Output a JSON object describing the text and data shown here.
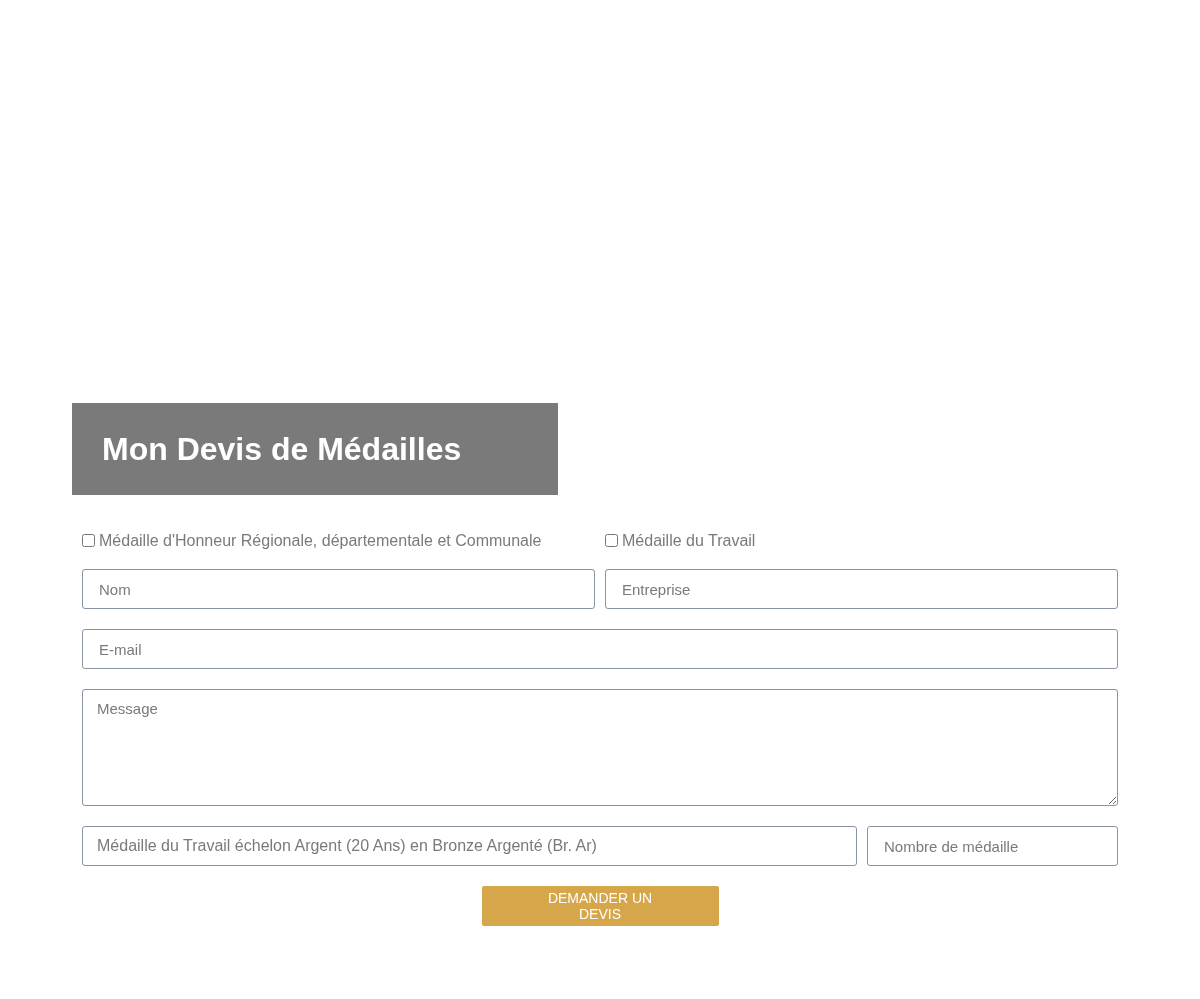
{
  "heading": "Mon Devis de Médailles",
  "checkboxes": [
    {
      "label": "Médaille d'Honneur Régionale, départementale et Communale",
      "checked": false
    },
    {
      "label": "Médaille du Travail",
      "checked": false
    }
  ],
  "fields": {
    "name": {
      "placeholder": "Nom"
    },
    "company": {
      "placeholder": "Entreprise"
    },
    "email": {
      "placeholder": "E-mail"
    },
    "message": {
      "placeholder": "Message"
    },
    "product": {
      "value": "Médaille du Travail échelon Argent (20 Ans) en Bronze Argenté (Br. Ar)"
    },
    "quantity": {
      "placeholder": "Nombre de médaille"
    }
  },
  "submit_button": "DEMANDER UN DEVIS"
}
